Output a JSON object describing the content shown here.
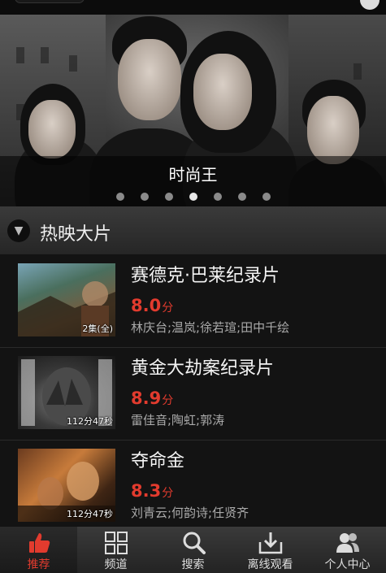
{
  "banner": {
    "caption": "时尚王",
    "dot_count": 7,
    "active_dot": 4
  },
  "section": {
    "title": "热映大片"
  },
  "movies": [
    {
      "name": "赛德克·巴莱纪录片",
      "score": "8.0",
      "score_unit": "分",
      "cast": "林庆台;温岚;徐若瑄;田中千绘",
      "badge": "2集(全)"
    },
    {
      "name": "黄金大劫案纪录片",
      "score": "8.9",
      "score_unit": "分",
      "cast": "雷佳音;陶虹;郭涛",
      "badge": "112分47秒"
    },
    {
      "name": "夺命金",
      "score": "8.3",
      "score_unit": "分",
      "cast": "刘青云;何韵诗;任贤齐",
      "badge": "112分47秒"
    }
  ],
  "nav": {
    "items": [
      {
        "label": "推荐",
        "icon": "thumbs-up-icon",
        "active": true
      },
      {
        "label": "频道",
        "icon": "grid-icon",
        "active": false
      },
      {
        "label": "搜索",
        "icon": "search-icon",
        "active": false
      },
      {
        "label": "离线观看",
        "icon": "download-icon",
        "active": false
      },
      {
        "label": "个人中心",
        "icon": "user-icon",
        "active": false
      }
    ]
  },
  "colors": {
    "accent_red": "#e23b2e",
    "background": "#121212"
  }
}
